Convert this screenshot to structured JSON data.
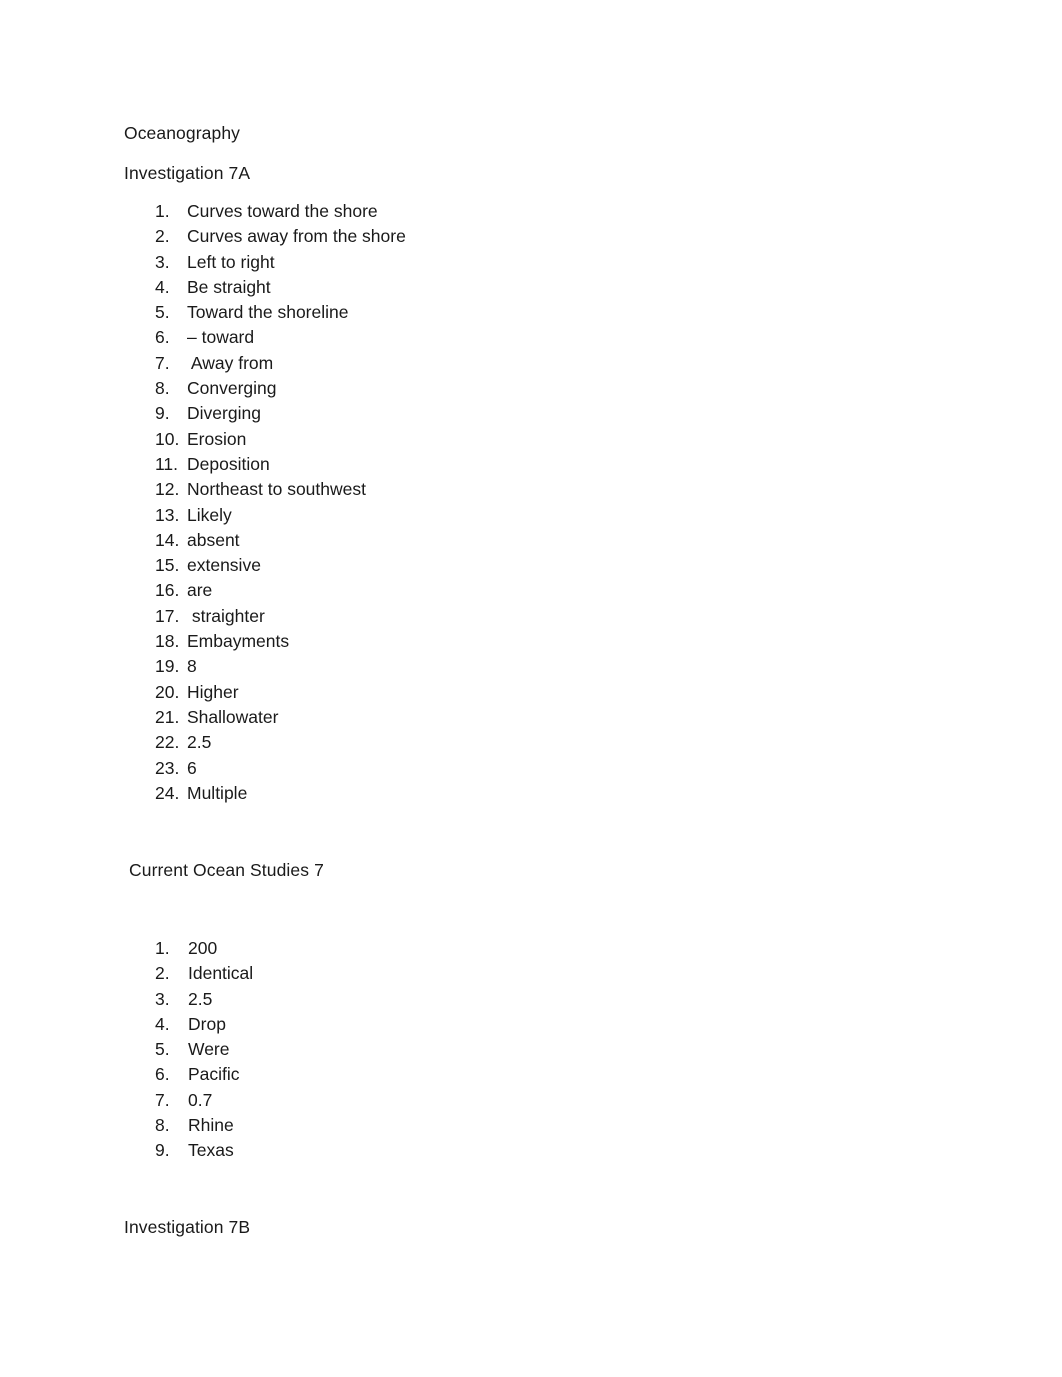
{
  "document": {
    "heading_oceanography": "Oceanography",
    "heading_investigation_7a": "Investigation 7A",
    "heading_current_ocean_studies": "Current Ocean Studies 7",
    "heading_investigation_7b": "Investigation 7B"
  },
  "investigation_7a_answers": [
    {
      "number": "1.",
      "text": "Curves toward the shore"
    },
    {
      "number": "2.",
      "text": "Curves away from the shore"
    },
    {
      "number": "3.",
      "text": "Left to right"
    },
    {
      "number": "4.",
      "text": "Be straight"
    },
    {
      "number": "5.",
      "text": "Toward the shoreline"
    },
    {
      "number": "6.",
      "text": "– toward"
    },
    {
      "number": "7.",
      "text": " Away from"
    },
    {
      "number": "8.",
      "text": "Converging"
    },
    {
      "number": "9.",
      "text": "Diverging"
    },
    {
      "number": "10.",
      "text": "Erosion"
    },
    {
      "number": "11.",
      "text": "Deposition"
    },
    {
      "number": "12.",
      "text": "Northeast to southwest"
    },
    {
      "number": "13.",
      "text": "Likely"
    },
    {
      "number": "14.",
      "text": "absent"
    },
    {
      "number": "15.",
      "text": "extensive"
    },
    {
      "number": "16.",
      "text": "are"
    },
    {
      "number": "17.",
      "text": " straighter"
    },
    {
      "number": "18.",
      "text": "Embayments"
    },
    {
      "number": "19.",
      "text": "8"
    },
    {
      "number": "20.",
      "text": "Higher"
    },
    {
      "number": "21.",
      "text": "Shallowater"
    },
    {
      "number": "22.",
      "text": "2.5"
    },
    {
      "number": "23.",
      "text": "6"
    },
    {
      "number": "24.",
      "text": "Multiple"
    }
  ],
  "current_ocean_studies_7_answers": [
    {
      "number": "1.",
      "text": "200"
    },
    {
      "number": "2.",
      "text": "Identical"
    },
    {
      "number": "3.",
      "text": "2.5"
    },
    {
      "number": "4.",
      "text": "Drop"
    },
    {
      "number": "5.",
      "text": "Were"
    },
    {
      "number": "6.",
      "text": "Pacific"
    },
    {
      "number": "7.",
      "text": "0.7"
    },
    {
      "number": "8.",
      "text": "Rhine"
    },
    {
      "number": "9.",
      "text": "Texas"
    }
  ],
  "colors": {
    "page_background": "#ffffff",
    "text": "#1a1a1a"
  }
}
